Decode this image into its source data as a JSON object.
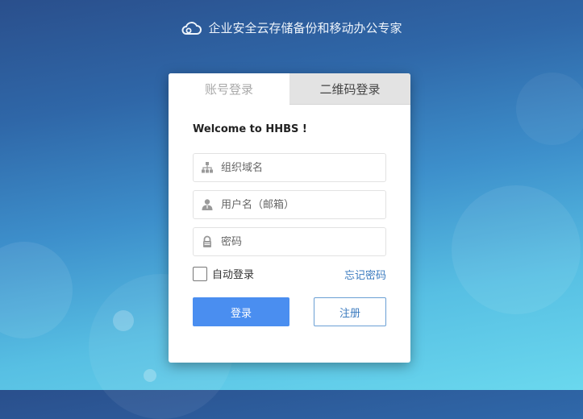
{
  "header": {
    "slogan": "企业安全云存储备份和移动办公专家",
    "logo_icon": "cloud-icon"
  },
  "tabs": [
    {
      "label": "账号登录",
      "active": true
    },
    {
      "label": "二维码登录",
      "active": false
    }
  ],
  "form": {
    "welcome": "Welcome to HHBS !",
    "org_field": {
      "placeholder": "组织域名",
      "value": "",
      "icon": "org-tree-icon"
    },
    "user_field": {
      "placeholder": "用户名（邮箱）",
      "value": "",
      "icon": "user-icon"
    },
    "password_field": {
      "placeholder": "密码",
      "value": "",
      "icon": "lock-icon"
    },
    "auto_login_label": "自动登录",
    "auto_login_checked": false,
    "forgot_label": "忘记密码",
    "login_label": "登录",
    "register_label": "注册"
  },
  "colors": {
    "primary": "#4a8ef0",
    "link": "#3b7bbf"
  }
}
